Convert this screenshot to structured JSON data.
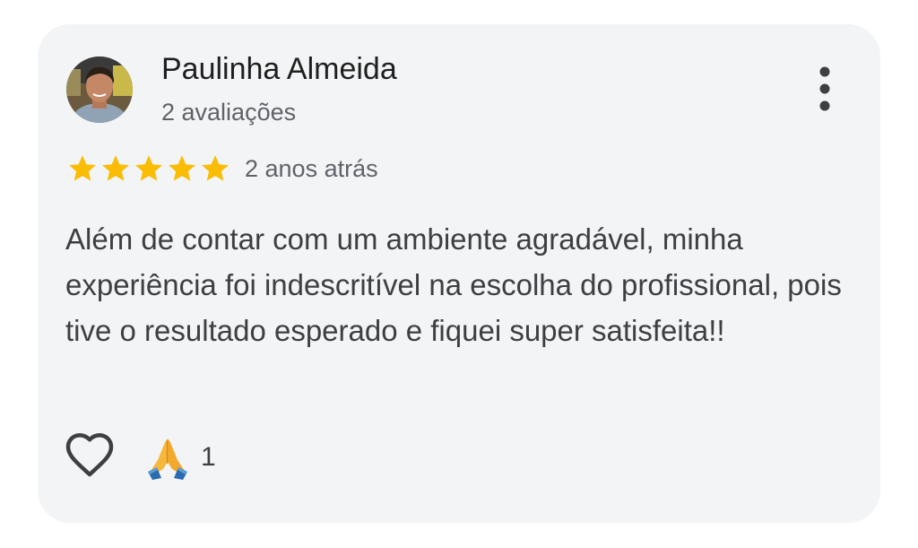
{
  "review": {
    "author_name": "Paulinha Almeida",
    "author_review_count": "2 avaliações",
    "rating": 5,
    "rating_max": 5,
    "time_ago": "2 anos atrás",
    "text": "Além de contar com um ambiente agradável, minha experiência foi indescritível na escolha do profissional, pois tive o resultado esperado e fiquei super satisfeita!!",
    "reaction_icon": "folded-hands-emoji",
    "reaction_count": "1",
    "like_icon": "heart-outline-icon",
    "menu_icon": "more-vertical-icon"
  },
  "colors": {
    "card_background": "#f3f4f6",
    "star": "#fbbc04",
    "text_primary": "#1f1f1f",
    "text_secondary": "#5f6368",
    "text_body": "#3c4043"
  }
}
